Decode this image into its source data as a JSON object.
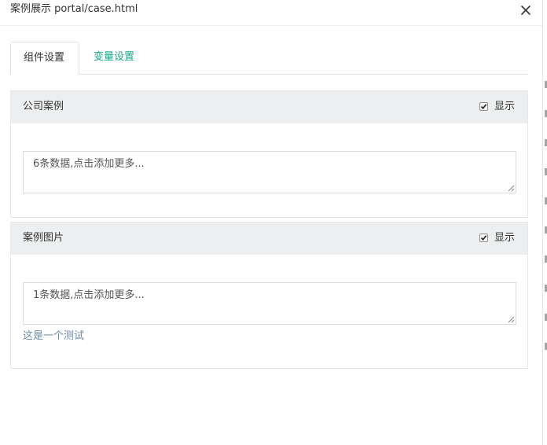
{
  "modal": {
    "title": "案例展示 portal/case.html",
    "close_icon": "close-icon"
  },
  "tabs": [
    {
      "label": "组件设置",
      "active": true
    },
    {
      "label": "变量设置",
      "active": false
    }
  ],
  "panels": [
    {
      "title": "公司案例",
      "show_label": "显示",
      "show_checked": true,
      "data_text": "6条数据,点击添加更多..."
    },
    {
      "title": "案例图片",
      "show_label": "显示",
      "show_checked": true,
      "data_text": "1条数据,点击添加更多...",
      "note": "这是一个测试"
    }
  ],
  "colors": {
    "accent": "#18a689",
    "panel_header_bg": "#eceeef",
    "note_text": "#6d8ba5"
  }
}
